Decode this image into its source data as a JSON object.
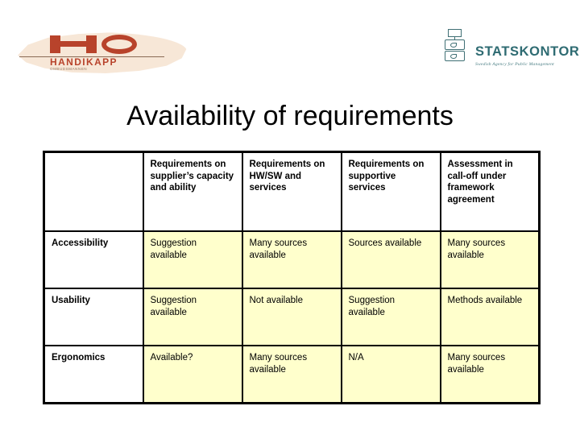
{
  "logos": {
    "ho": {
      "wordmark": "HANDIKAPP",
      "subtitle": "OMBUDSMANNEN",
      "monogram": "HO",
      "color": "#b8432b"
    },
    "statskontoret": {
      "name": "STATSKONTORET",
      "subtitle": "Swedish Agency for Public Management",
      "color": "#2e6b72"
    }
  },
  "title": "Availability of requirements",
  "table": {
    "corner_label": "",
    "columns": [
      "Requirements on supplier’s capacity and ability",
      "Requirements on HW/SW and services",
      "Requirements on supportive services",
      "Assessment in call-off under framework agreement"
    ],
    "rows": [
      {
        "label": "Accessibility",
        "cells": [
          "Suggestion available",
          "Many sources available",
          "Sources available",
          "Many sources available"
        ]
      },
      {
        "label": "Usability",
        "cells": [
          "Suggestion available",
          "Not available",
          "Suggestion available",
          "Methods available"
        ]
      },
      {
        "label": "Ergonomics",
        "cells": [
          "Available?",
          "Many sources available",
          "N/A",
          "Many sources available"
        ]
      }
    ],
    "cell_fill": "#ffffcc",
    "label_fill": "#ffffff",
    "border_color": "#000000"
  }
}
